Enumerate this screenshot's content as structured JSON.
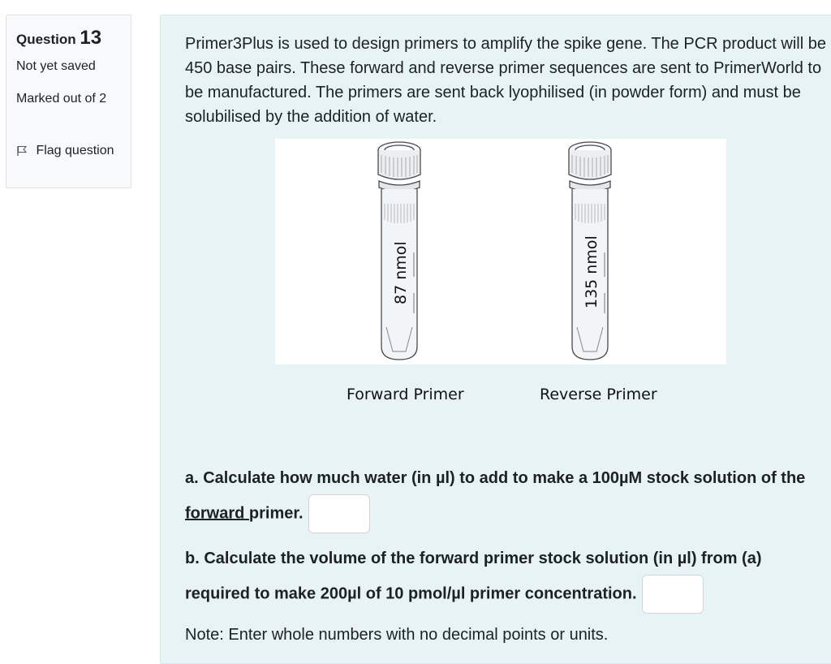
{
  "info": {
    "question_label": "Question",
    "question_number": "13",
    "state": "Not yet saved",
    "grade": "Marked out of 2",
    "flag_label": "Flag question",
    "flag_icon": "flag-icon"
  },
  "question": {
    "intro": "Primer3Plus is used to design primers to amplify the spike gene. The PCR product will be 450 base pairs. These forward and reverse primer sequences are sent to PrimerWorld to be manufactured. The primers are sent back lyophilised (in powder form) and must be solubilised by the addition of water.",
    "tubes": [
      {
        "label": "87 nmol",
        "caption": "Forward Primer"
      },
      {
        "label": "135 nmol",
        "caption": "Reverse Primer"
      }
    ],
    "part_a": {
      "before": "a. Calculate how much water (in µl) to add to make a 100µM stock solution of the ",
      "underlined": "forward ",
      "after": "primer.",
      "answer_value": ""
    },
    "part_b": {
      "text": "b. Calculate the volume of the forward primer stock solution (in µl) from (a) required to make 200µl of 10 pmol/µl primer concentration.",
      "answer_value": ""
    },
    "note": "Note: Enter whole numbers with no decimal points or units."
  }
}
